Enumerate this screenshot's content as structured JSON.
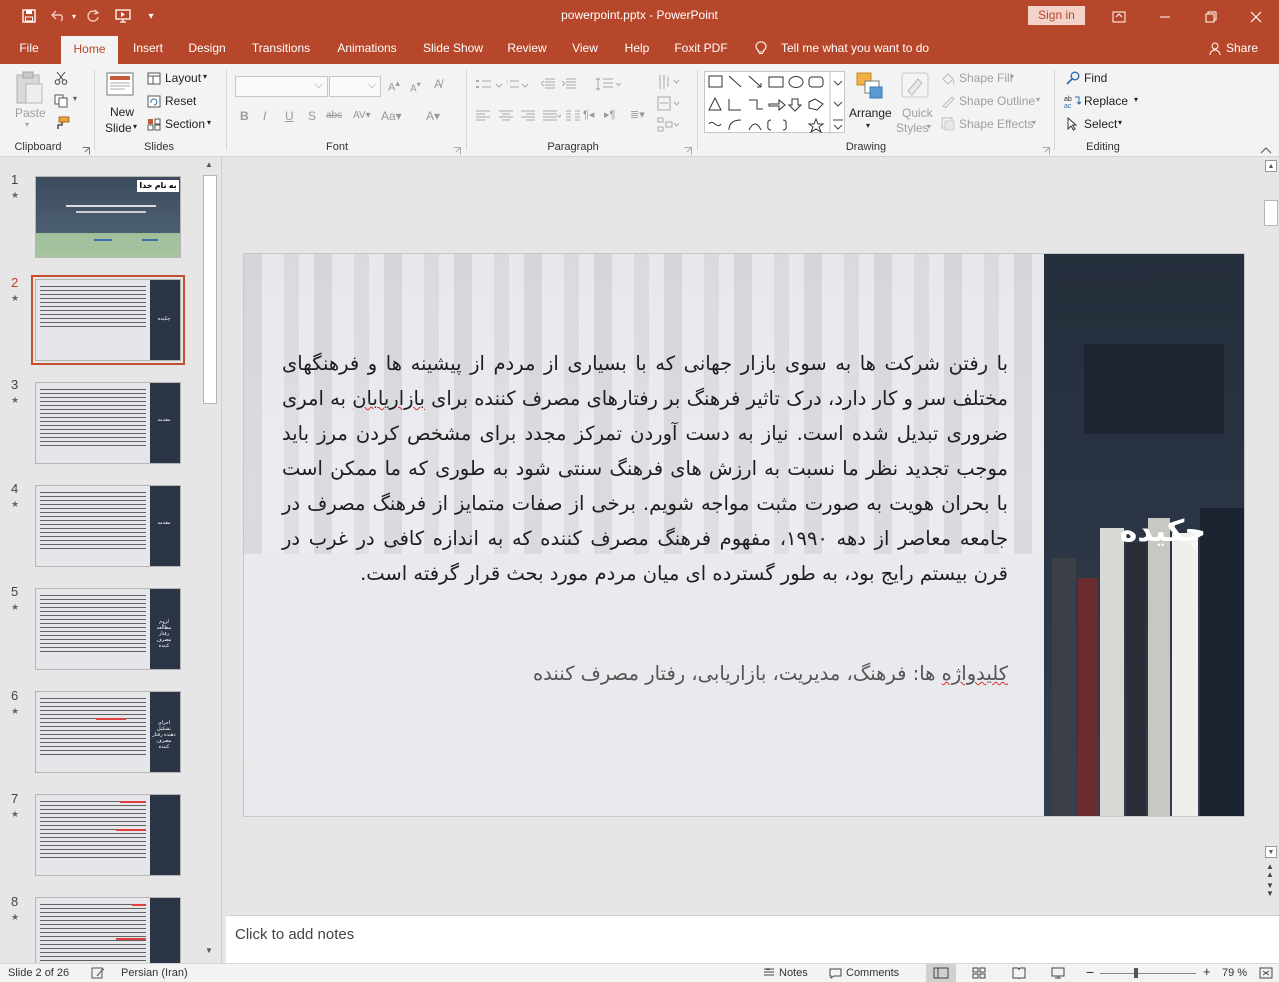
{
  "app": {
    "title": "powerpoint.pptx  -  PowerPoint",
    "sign_in": "Sign in"
  },
  "tabs": [
    "File",
    "Home",
    "Insert",
    "Design",
    "Transitions",
    "Animations",
    "Slide Show",
    "Review",
    "View",
    "Help",
    "Foxit PDF"
  ],
  "active_tab": "Home",
  "tell_me": "Tell me what you want to do",
  "share": "Share",
  "ribbon": {
    "clipboard": {
      "label": "Clipboard",
      "paste": "Paste"
    },
    "slides": {
      "label": "Slides",
      "new_slide_1": "New",
      "new_slide_2": "Slide",
      "layout": "Layout",
      "reset": "Reset",
      "section": "Section"
    },
    "font": {
      "label": "Font"
    },
    "paragraph": {
      "label": "Paragraph"
    },
    "drawing": {
      "label": "Drawing",
      "arrange": "Arrange",
      "quick_styles_1": "Quick",
      "quick_styles_2": "Styles",
      "shape_fill": "Shape Fill",
      "shape_outline": "Shape Outline",
      "shape_effects": "Shape Effects"
    },
    "editing": {
      "label": "Editing",
      "find": "Find",
      "replace": "Replace",
      "select": "Select"
    }
  },
  "thumbnails": [
    {
      "num": "1",
      "title": "به نام خدا"
    },
    {
      "num": "2",
      "title": "چکیده"
    },
    {
      "num": "3",
      "title": "مقدمه"
    },
    {
      "num": "4",
      "title": "مقدمه"
    },
    {
      "num": "5",
      "title": "لزوم مطالعه رفتار مصرف کننده"
    },
    {
      "num": "6",
      "title": "اجزای تشکیل دهنده رفتار مصرف کننده"
    },
    {
      "num": "7",
      "title": ""
    },
    {
      "num": "8",
      "title": ""
    }
  ],
  "slide": {
    "title": "چکیده",
    "body_1": "با رفتن شرکت ها به سوی بازار جهانی که با بسیاری از مردم از پیشینه ها و فرهنگهای مختلف سر و کار دارد، درک تاثیر فرهنگ بر رفتارهای مصرف کننده برای ",
    "body_squiggle": "بازاریابان",
    "body_2": " به امری ضروری تبدیل شده است. نیاز به دست آوردن تمرکز مجدد برای مشخص کردن مرز باید موجب تجدید نظر ما نسبت به ارزش های فرهنگ سنتی شود به طوری که ما ممکن است با بحران هویت به صورت مثبت مواجه شویم. برخی از صفات متمایز از فرهنگ مصرف در جامعه معاصر از دهه ۱۹۹۰، مفهوم فرهنگ مصرف کننده که به اندازه کافی در غرب در قرن بیستم رایج بود، به طور گسترده ای میان مردم مورد بحث قرار گرفته است.",
    "keywords_squiggle": "کلیدواژه",
    "keywords_rest": " ها: فرهنگ، مدیریت، بازاریابی، رفتار مصرف کننده"
  },
  "notes_placeholder": "Click to add notes",
  "status": {
    "slide_info": "Slide 2 of 26",
    "language": "Persian (Iran)",
    "notes": "Notes",
    "comments": "Comments",
    "zoom": "79 %"
  },
  "colors": {
    "accent": "#b7472a",
    "panel": "#2a3443"
  }
}
